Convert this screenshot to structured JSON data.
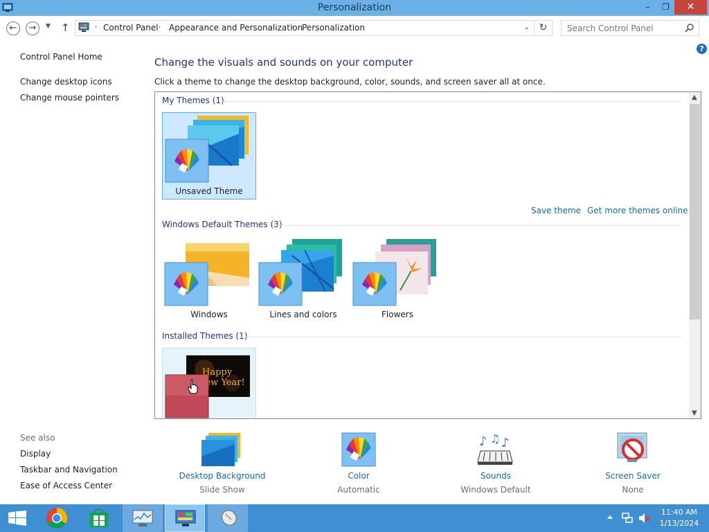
{
  "window": {
    "title": "Personalization",
    "minimize": "–",
    "maximize": "❐",
    "close": "✕"
  },
  "address_bar": {
    "back": "←",
    "forward": "→",
    "up": "↑",
    "breadcrumb": [
      "Control Panel",
      "Appearance and Personalization",
      "Personalization"
    ],
    "separator": "›",
    "search_placeholder": "Search Control Panel",
    "help": "?"
  },
  "left_nav": {
    "home": "Control Panel Home",
    "links": [
      "Change desktop icons",
      "Change mouse pointers"
    ],
    "see_also_title": "See also",
    "see_also": [
      "Display",
      "Taskbar and Navigation",
      "Ease of Access Center"
    ]
  },
  "main": {
    "heading": "Change the visuals and sounds on your computer",
    "subtext": "Click a theme to change the desktop background, color, sounds, and screen saver all at once.",
    "groups": {
      "my_themes": "My Themes (1)",
      "default_themes": "Windows Default Themes (3)",
      "installed_themes": "Installed Themes (1)"
    },
    "themes": {
      "unsaved": "Unsaved Theme",
      "windows": "Windows",
      "lines": "Lines and colors",
      "flowers": "Flowers",
      "new_year_text_1": "Happy",
      "new_year_text_2": "New Year!"
    },
    "save_theme": "Save theme",
    "get_more": "Get more themes online"
  },
  "bottom": {
    "desktop_background": {
      "name": "Desktop Background",
      "value": "Slide Show"
    },
    "color": {
      "name": "Color",
      "value": "Automatic"
    },
    "sounds": {
      "name": "Sounds",
      "value": "Windows Default"
    },
    "screen_saver": {
      "name": "Screen Saver",
      "value": "None"
    }
  },
  "taskbar": {
    "time": "11:40 AM",
    "date": "1/13/2024"
  },
  "colors": {
    "title_bar": "#6bb1e6",
    "close_button": "#c7443d",
    "link": "#1a66b8",
    "heading": "#1e3287",
    "taskbar": "#3f8fd2",
    "selection": "#cde8ff"
  }
}
